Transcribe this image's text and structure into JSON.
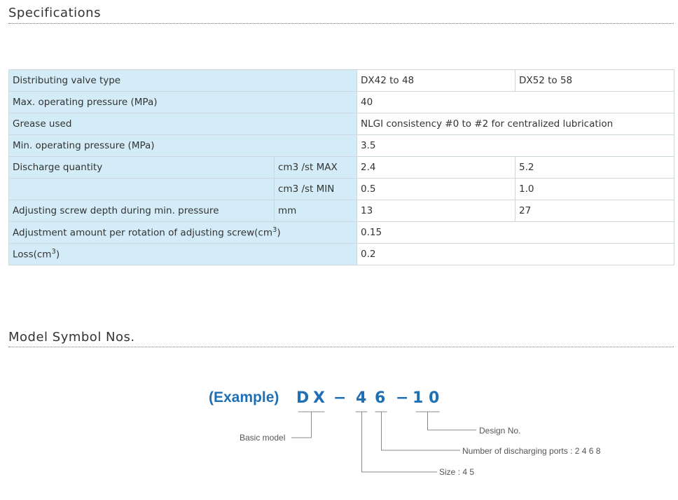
{
  "specifications": {
    "title": "Specifications",
    "rows": {
      "valve_type": {
        "label": "Distributing valve type",
        "v1": "DX42 to 48",
        "v2": "DX52 to 58"
      },
      "max_pressure": {
        "label": "Max. operating pressure (MPa)",
        "value": "40"
      },
      "grease": {
        "label": "Grease used",
        "value": "NLGI consistency #0 to #2 for centralized lubrication"
      },
      "min_pressure": {
        "label": "Min. operating pressure (MPa)",
        "value": "3.5"
      },
      "discharge_max": {
        "label": "Discharge quantity",
        "unit": "cm3 /st MAX",
        "v1": "2.4",
        "v2": "5.2"
      },
      "discharge_min": {
        "unit": "cm3 /st MIN",
        "v1": "0.5",
        "v2": "1.0"
      },
      "screw_depth": {
        "label": "Adjusting screw depth during min. pressure",
        "unit": "mm",
        "v1": "13",
        "v2": "27"
      },
      "adjust_amount": {
        "label": "Adjustment amount per rotation of adjusting screw(cm",
        "sup": "3",
        "close": ")",
        "value": "0.15"
      },
      "loss": {
        "label": "Loss(cm",
        "sup": "3",
        "close": ")",
        "value": "0.2"
      }
    }
  },
  "model_symbol": {
    "title": "Model Symbol Nos.",
    "example_label": "(Example)",
    "chars": {
      "d": "D",
      "x": "X",
      "dash1": "−",
      "four": "4",
      "six": "6",
      "dash2": "−",
      "one": "1",
      "zero": "0"
    },
    "labels": {
      "basic_model": "Basic model",
      "design_no": "Design No.",
      "ports": "Number of discharging ports : 2 4 6 8",
      "size": "Size : 4 5"
    }
  },
  "colors": {
    "header_bg": "#d3ecf7",
    "accent": "#1f6fb5",
    "border": "#cdd8de"
  }
}
